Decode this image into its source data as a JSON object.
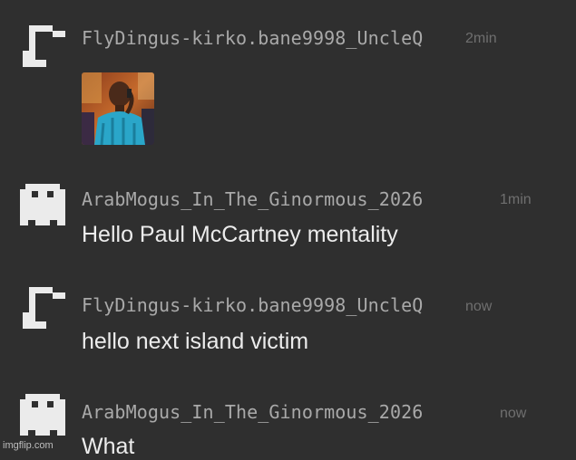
{
  "messages": [
    {
      "username": "FlyDingus-kirko.bane9998_UncleQ",
      "time": "2min",
      "avatar_icon": "pixel-hook-avatar-icon",
      "attachment": "image-attachment"
    },
    {
      "username": "ArabMogus_In_The_Ginormous_2026",
      "time": "1min",
      "avatar_icon": "pixel-ghost-avatar-icon",
      "text": "Hello Paul McCartney mentality"
    },
    {
      "username": "FlyDingus-kirko.bane9998_UncleQ",
      "time": "now",
      "avatar_icon": "pixel-hook-avatar-icon",
      "text": "hello next island victim"
    },
    {
      "username": "ArabMogus_In_The_Ginormous_2026",
      "time": "now",
      "avatar_icon": "pixel-ghost-avatar-icon",
      "text": "What"
    }
  ],
  "watermark": "imgflip.com",
  "colors": {
    "background": "#2f2f2f",
    "username": "#a9a9a9",
    "timestamp": "#6f6f6f",
    "message_text": "#ececec",
    "avatar": "#ebebeb"
  }
}
